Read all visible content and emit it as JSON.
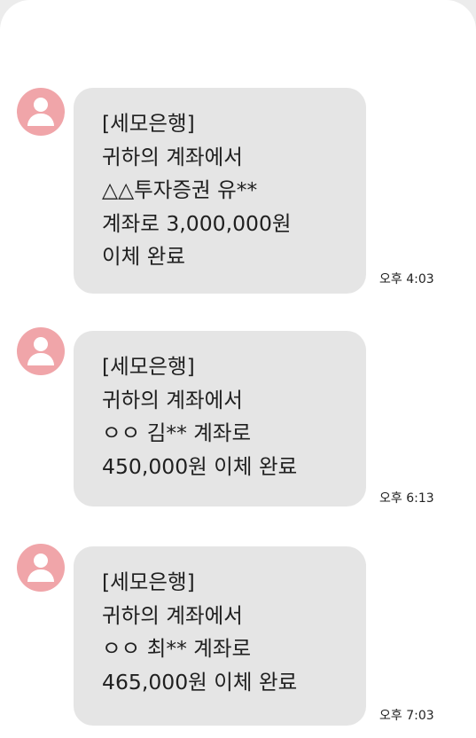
{
  "messages": [
    {
      "lines": [
        "[세모은행]",
        "귀하의 계좌에서",
        "△△투자증권 유**",
        "계좌로 3,000,000원",
        "이체 완료"
      ],
      "time": "오후 4:03"
    },
    {
      "lines": [
        "[세모은행]",
        "귀하의 계좌에서",
        "ㅇㅇ 김** 계좌로",
        "450,000원 이체 완료"
      ],
      "time": "오후 6:13"
    },
    {
      "lines": [
        "[세모은행]",
        "귀하의 계좌에서",
        "ㅇㅇ 최** 계좌로",
        "465,000원 이체 완료"
      ],
      "time": "오후 7:03"
    }
  ],
  "colors": {
    "bubble": "#e5e5e5",
    "avatar": "#f0a5a9",
    "background": "#ffffff"
  }
}
